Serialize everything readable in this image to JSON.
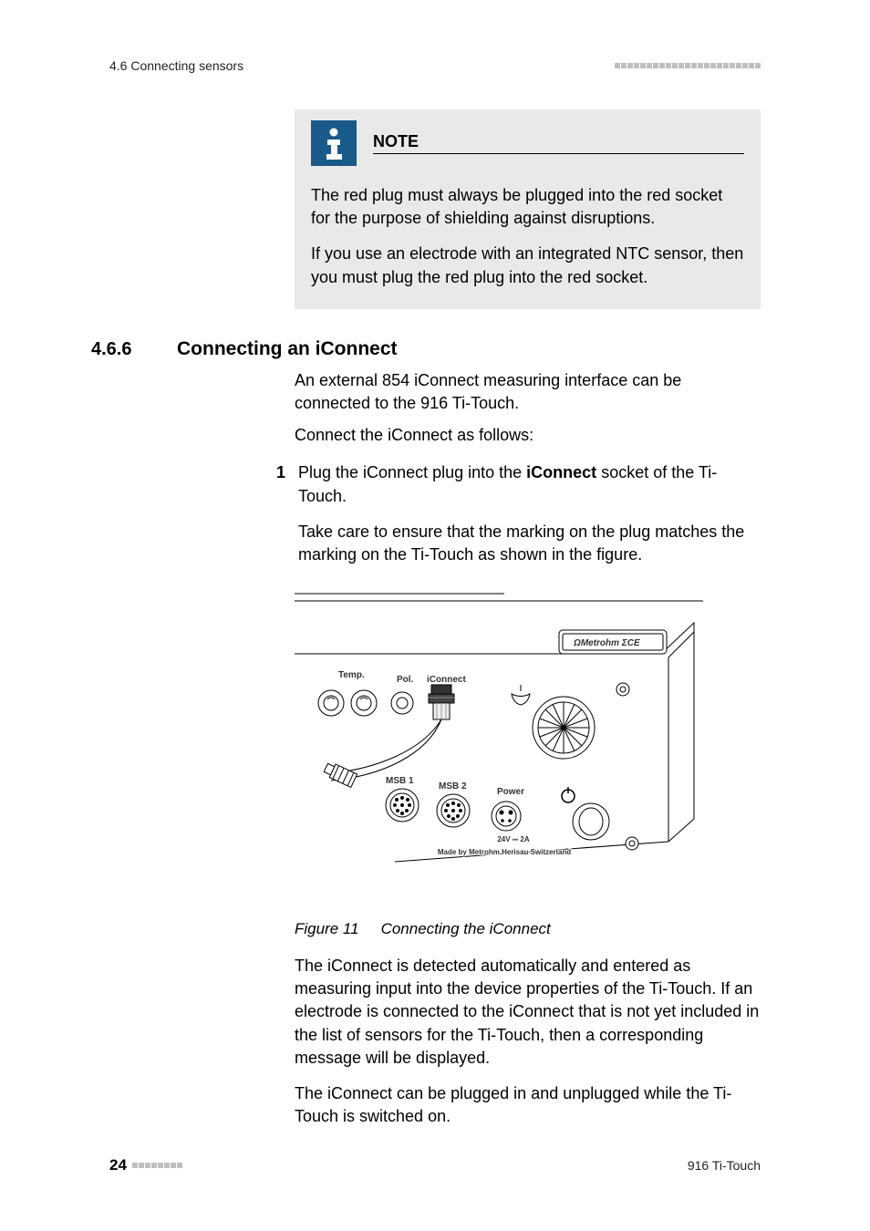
{
  "header": {
    "section_ref": "4.6 Connecting sensors"
  },
  "note": {
    "title": "NOTE",
    "p1": "The red plug must always be plugged into the red socket for the purpose of shielding against disruptions.",
    "p2": "If you use an electrode with an integrated NTC sensor, then you must plug the red plug into the red socket."
  },
  "section": {
    "number": "4.6.6",
    "title": "Connecting an iConnect",
    "intro1": "An external 854 iConnect measuring interface can be connected to the 916 Ti-Touch.",
    "intro2": "Connect the iConnect as follows:"
  },
  "step1": {
    "num": "1",
    "line1_pre": "Plug the iConnect plug into the ",
    "line1_bold": "iConnect",
    "line1_post": " socket of the Ti-Touch.",
    "line2": "Take care to ensure that the marking on the plug matches the marking on the Ti-Touch as shown in the figure."
  },
  "figure": {
    "caption_label": "Figure 11",
    "caption_text": "Connecting the iConnect",
    "labels": {
      "brand": "Metrohm",
      "ce": "CE",
      "temp": "Temp.",
      "pol": "Pol.",
      "iconnect": "iConnect",
      "msb1": "MSB 1",
      "msb2": "MSB 2",
      "power": "Power",
      "volt": "24V ⎓ 2A",
      "made": "Made by Metrohm Herisau Switzerland"
    }
  },
  "after": {
    "p1": "The iConnect is detected automatically and entered as measuring input into the device properties of the Ti-Touch. If an electrode is connected to the iConnect that is not yet included in the list of sensors for the Ti-Touch, then a corresponding message will be displayed.",
    "p2": "The iConnect can be plugged in and unplugged while the Ti-Touch is switched on."
  },
  "footer": {
    "page": "24",
    "product": "916 Ti-Touch"
  }
}
